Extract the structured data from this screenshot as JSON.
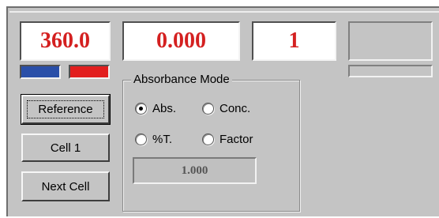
{
  "readouts": {
    "wavelength": "360.0",
    "absorbance": "0.000",
    "cell_number": "1"
  },
  "indicators": {
    "blue_color": "#2a4fa8",
    "red_color": "#e21e1e"
  },
  "buttons": {
    "reference": "Reference",
    "cell1": "Cell 1",
    "next_cell": "Next Cell"
  },
  "absorbance_mode": {
    "title": "Absorbance Mode",
    "options": [
      {
        "label": "Abs.",
        "selected": true
      },
      {
        "label": "Conc.",
        "selected": false
      },
      {
        "label": "%T.",
        "selected": false
      },
      {
        "label": "Factor",
        "selected": false
      }
    ],
    "factor_value": "1.000"
  },
  "colors": {
    "readout_text": "#d42020",
    "panel_background": "#c4c4c4"
  }
}
